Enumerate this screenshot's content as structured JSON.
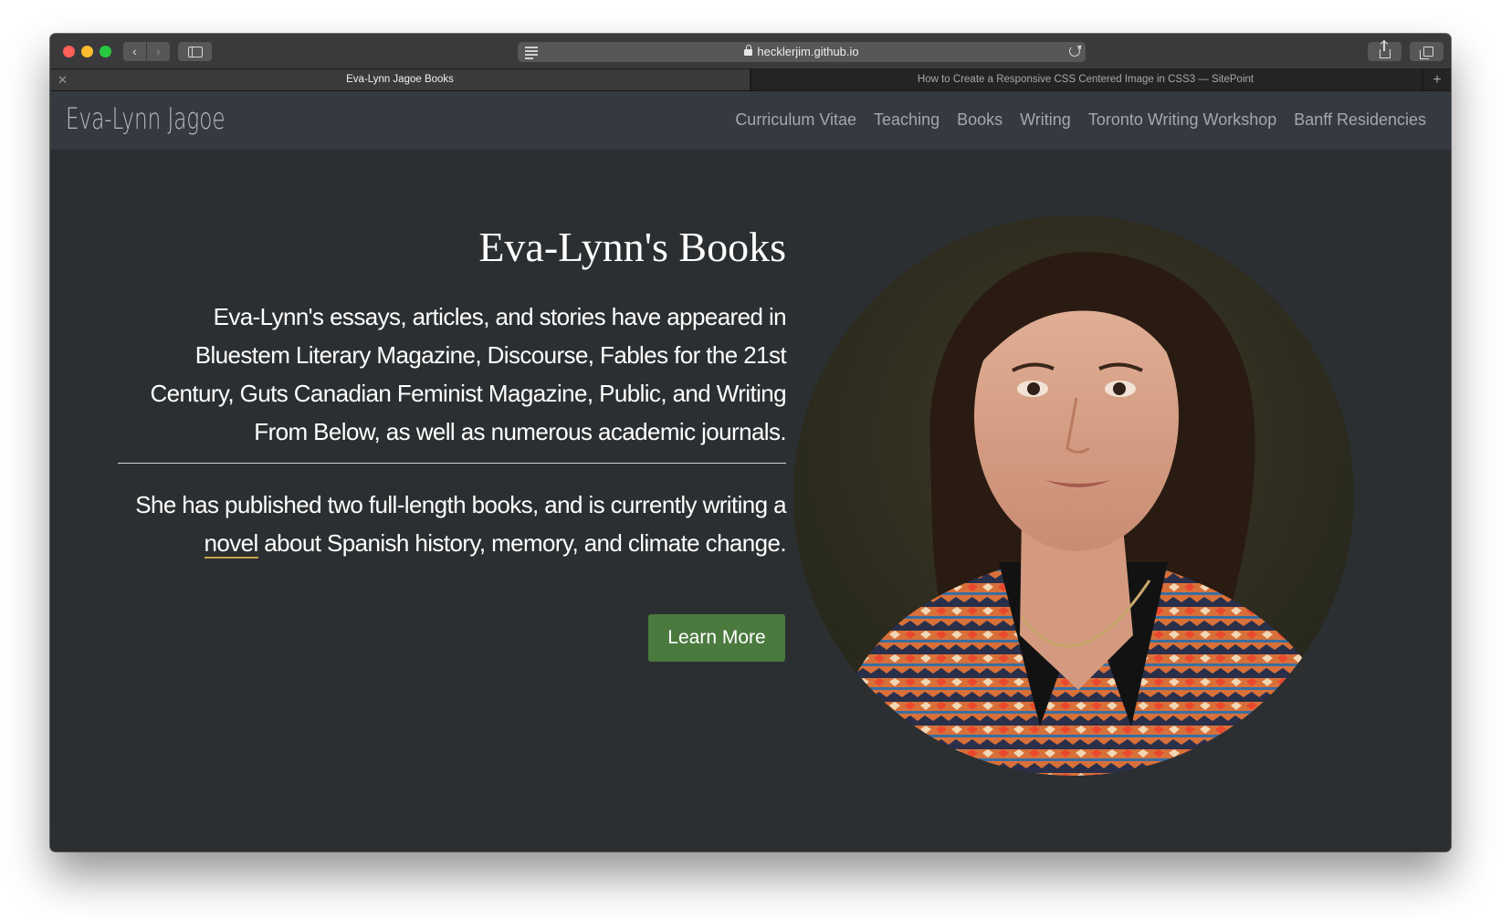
{
  "browser": {
    "url": "hecklerjim.github.io",
    "tabs": [
      {
        "title": "Eva-Lynn Jagoe Books",
        "active": true
      },
      {
        "title": "How to Create a Responsive CSS Centered Image in CSS3 — SitePoint",
        "active": false
      }
    ],
    "icons": [
      "back-icon",
      "forward-icon",
      "sidebar-icon",
      "reader-icon",
      "lock-icon",
      "reload-icon",
      "share-icon",
      "tabs-overview-icon",
      "new-tab-icon",
      "close-tab-icon"
    ]
  },
  "site": {
    "logo": "Eva-Lynn Jagoe",
    "nav": [
      "Curriculum Vitae",
      "Teaching",
      "Books",
      "Writing",
      "Toronto Writing Workshop",
      "Banff Residencies"
    ],
    "title": "Eva-Lynn's Books",
    "paragraph1": "Eva-Lynn's essays, articles, and stories have appeared in Bluestem Literary Magazine, Discourse, Fables for the 21st Century, Guts Canadian Feminist Magazine, Public, and Writing From Below, as well as numerous academic journals.",
    "paragraph2": {
      "before": "She has published two full-length books, and is currently writing a ",
      "link": "novel",
      "after": " about Spanish history, memory, and climate change."
    },
    "button": "Learn More"
  },
  "colors": {
    "page_bg": "#2c2f31",
    "navbar_bg": "#353a40",
    "nav_text": "#a3a8ad",
    "button_bg": "#4a7a3e",
    "link_underline": "#c8a24a"
  }
}
